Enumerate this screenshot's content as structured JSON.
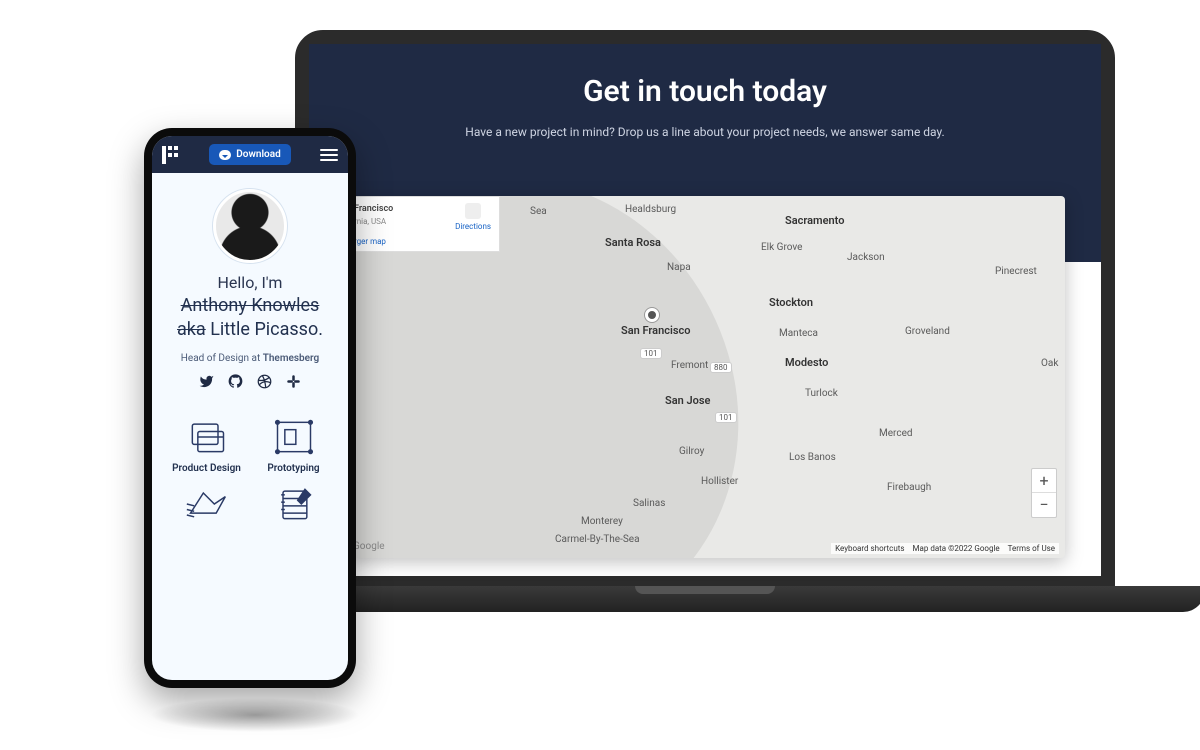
{
  "laptop": {
    "contact": {
      "title": "Get in touch today",
      "subtitle": "Have a new project in mind? Drop us a line about your project needs, we answer same day."
    },
    "map": {
      "info_card": {
        "title": "Francisco",
        "subline": "rnia, USA",
        "directions": "Directions",
        "larger": "rger map"
      },
      "cities": {
        "san_francisco": "San Francisco",
        "sacramento": "Sacramento",
        "stockton": "Stockton",
        "modesto": "Modesto",
        "fremont": "Fremont",
        "san_jose": "San Jose",
        "santa_rosa": "Santa Rosa",
        "napa": "Napa",
        "healdsburg": "Healdsburg",
        "elk_grove": "Elk Grove",
        "jackson": "Jackson",
        "pinecrest": "Pinecrest",
        "manteca": "Manteca",
        "groveland": "Groveland",
        "turlock": "Turlock",
        "merced": "Merced",
        "los_banos": "Los Banos",
        "gilroy": "Gilroy",
        "hollister": "Hollister",
        "firebaugh": "Firebaugh",
        "monterey": "Monterey",
        "salinas": "Salinas",
        "carmel": "Carmel-By-The-Sea",
        "oak": "Oak",
        "sea": "Sea"
      },
      "controls": {
        "zoom_in": "+",
        "zoom_out": "−"
      },
      "footer": {
        "keyboard": "Keyboard shortcuts",
        "mapdata": "Map data ©2022 Google",
        "terms": "Terms of Use"
      },
      "brand": "Google"
    }
  },
  "phone": {
    "topbar": {
      "download": "Download"
    },
    "profile": {
      "hello": "Hello, I'm",
      "strike_name": "Anthony Knowles",
      "aka": "aka",
      "alias": "Little Picasso.",
      "role_prefix": "Head of Design at ",
      "role_company": "Themesberg"
    },
    "skills": {
      "product_design": "Product Design",
      "prototyping": "Prototyping"
    }
  }
}
